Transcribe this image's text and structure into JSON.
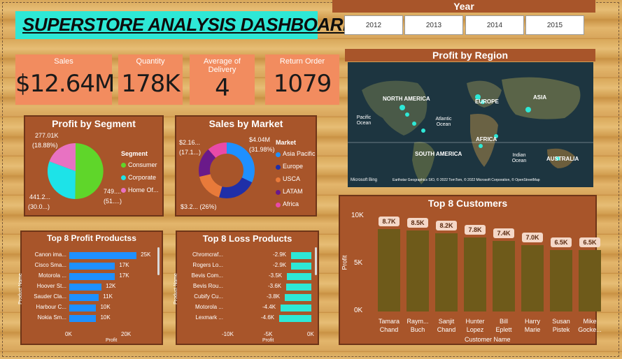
{
  "title": "SUPERSTORE ANALYSIS DASHBOARD",
  "year_slicer": {
    "label": "Year",
    "options": [
      "2012",
      "2013",
      "2014",
      "2015"
    ]
  },
  "kpis": [
    {
      "label": "Sales",
      "value": "$12.64M"
    },
    {
      "label": "Quantity",
      "value": "178K"
    },
    {
      "label": "Average of Delivery",
      "value": "4"
    },
    {
      "label": "Return Order",
      "value": "1079"
    }
  ],
  "map": {
    "title": "Profit by Region",
    "labels": [
      "NORTH AMERICA",
      "EUROPE",
      "ASIA",
      "Pacific Ocean",
      "Atlantic Ocean",
      "AFRICA",
      "SOUTH AMERICA",
      "Indian Ocean",
      "AUSTRALIA"
    ],
    "attribution": "Earthstar Geographics SIO, © 2022 TomTom, © 2022 Microsoft Corporation, © OpenStreetMap",
    "brand": "Microsoft Bing"
  },
  "segment": {
    "title": "Profit by Segment",
    "legend_title": "Segment",
    "labels": {
      "top": "277.01K",
      "top_pct": "(18.88%)",
      "left": "441.2...",
      "left_pct": "(30.0...)",
      "right": "749....",
      "right_pct": "(51....)"
    },
    "items": [
      {
        "name": "Consumer",
        "color": "#5fd62a"
      },
      {
        "name": "Corporate",
        "color": "#1de3e8"
      },
      {
        "name": "Home Of...",
        "color": "#e872c2"
      }
    ]
  },
  "market": {
    "title": "Sales by Market",
    "legend_title": "Market",
    "labels": {
      "tl": "$2.16...",
      "tl_pct": "(17.1...)",
      "tr": "$4.04M",
      "tr_pct": "(31.98%)",
      "bl": "$3.2... (26%)"
    },
    "items": [
      {
        "name": "Asia Pacific",
        "color": "#1e90ff"
      },
      {
        "name": "Europe",
        "color": "#1f2fa8"
      },
      {
        "name": "USCA",
        "color": "#e87a3a"
      },
      {
        "name": "LATAM",
        "color": "#6a1a8a"
      },
      {
        "name": "Africa",
        "color": "#e84aa8"
      }
    ]
  },
  "chart_data": [
    {
      "type": "bar",
      "title": "Top 8 Profit Productss",
      "ylabel": "Product Name",
      "xlabel": "Profit",
      "categories": [
        "Canon ima...",
        "Cisco Sma...",
        "Motorola ...",
        "Hoover St...",
        "Sauder Cla...",
        "Harbour C...",
        "Nokia Sm..."
      ],
      "values": [
        25000,
        17000,
        17000,
        12000,
        11000,
        10000,
        10000
      ],
      "data_labels": [
        "25K",
        "17K",
        "17K",
        "12K",
        "11K",
        "10K",
        "10K"
      ],
      "xticks": [
        "0K",
        "20K"
      ],
      "xlim": [
        0,
        26000
      ],
      "color": "#1e90ff"
    },
    {
      "type": "bar",
      "title": "Top 8 Loss Products",
      "ylabel": "Product Name",
      "xlabel": "Profit",
      "categories": [
        "Chromcraf...",
        "Rogers Lo...",
        "Bevis Com...",
        "Bevis Rou...",
        "Cubify Cu...",
        "Motorola ...",
        "Lexmark ..."
      ],
      "values": [
        -2900,
        -2900,
        -3500,
        -3600,
        -3800,
        -4400,
        -4600
      ],
      "data_labels": [
        "-2.9K",
        "-2.9K",
        "-3.5K",
        "-3.6K",
        "-3.8K",
        "-4.4K",
        "-4.6K"
      ],
      "xticks": [
        "-10K",
        "-5K",
        "0K"
      ],
      "xlim": [
        -12000,
        0
      ],
      "color": "#2ee8d6"
    },
    {
      "type": "bar",
      "title": "Top 8 Customers",
      "ylabel": "Profit",
      "xlabel": "Customer Name",
      "categories": [
        "Tamara Chand",
        "Raym... Buch",
        "Sanjit Chand",
        "Hunter Lopez",
        "Bill Eplett",
        "Harry Marie",
        "Susan Pistek",
        "Mike Gocke..."
      ],
      "values": [
        8700,
        8500,
        8200,
        7800,
        7400,
        7000,
        6500,
        6500
      ],
      "data_labels": [
        "8.7K",
        "8.5K",
        "8.2K",
        "7.8K",
        "7.4K",
        "7.0K",
        "6.5K",
        "6.5K"
      ],
      "yticks": [
        "0K",
        "5K",
        "10K"
      ],
      "ylim": [
        0,
        10000
      ],
      "color": "#6e5a1a"
    }
  ]
}
